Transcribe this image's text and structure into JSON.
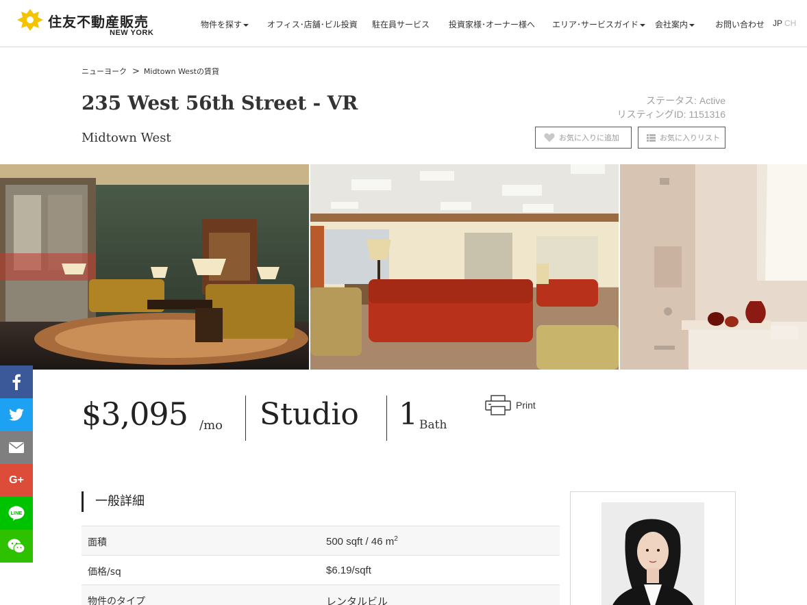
{
  "header": {
    "logo_name": "住友不動産販売",
    "logo_sub": "NEW YORK",
    "nav": [
      {
        "label": "物件を探す",
        "dropdown": true
      },
      {
        "label": "オフィス･店舗･ビル投資",
        "dropdown": false
      },
      {
        "label": "駐在員サービス",
        "dropdown": false
      },
      {
        "label": "投資家様･オーナー様へ",
        "dropdown": false
      },
      {
        "label": "エリア･サービスガイド",
        "dropdown": true
      },
      {
        "label": "会社案内",
        "dropdown": true
      },
      {
        "label": "お問い合わせ",
        "dropdown": false
      }
    ],
    "lang_active": "JP",
    "lang_other": "CH"
  },
  "breadcrumb": {
    "home": "ニューヨーク",
    "separator": ">",
    "current": "Midtown Westの賃貸"
  },
  "listing": {
    "title": "235 West 56th Street - VR",
    "neighborhood": "Midtown West",
    "status": "ステータス: Active",
    "listing_id": "リスティングID: 1151316",
    "fav_add_label": "お気に入りに追加",
    "fav_list_label": "お気に入りリスト"
  },
  "summary": {
    "price": "$3,095",
    "price_unit": "/mo",
    "type": "Studio",
    "baths": "1",
    "baths_unit": "Bath",
    "print_label": "Print"
  },
  "social": [
    {
      "name": "facebook",
      "color": "#3b5998"
    },
    {
      "name": "twitter",
      "color": "#1da1f2"
    },
    {
      "name": "email",
      "color": "#7f7f7f"
    },
    {
      "name": "google-plus",
      "color": "#dd4b39"
    },
    {
      "name": "line",
      "color": "#00c300"
    },
    {
      "name": "wechat",
      "color": "#2dc100"
    }
  ],
  "details": {
    "heading": "一般詳細",
    "rows": [
      {
        "key": "面積",
        "value": "500 sqft / 46 m",
        "sup": "2"
      },
      {
        "key": "価格/sq",
        "value": "$6.19/sqft",
        "sup": ""
      },
      {
        "key": "物件のタイプ",
        "value": "レンタルビル",
        "sup": ""
      }
    ]
  },
  "colors": {
    "logo_yellow": "#f5c400",
    "text": "#333333",
    "muted": "#a0a0a0"
  }
}
